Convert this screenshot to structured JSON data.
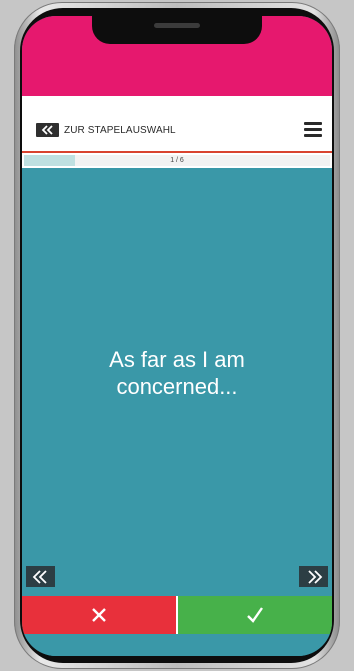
{
  "header": {
    "back_label": "ZUR STAPELAUSWAHL"
  },
  "progress": {
    "text": "1 / 6",
    "current": 1,
    "total": 6
  },
  "card": {
    "line1": "As far as I am",
    "line2": "concerned..."
  },
  "icons": {
    "back": "double-chevron-left-icon",
    "menu": "hamburger-menu-icon",
    "prev": "double-chevron-left-icon",
    "next": "double-chevron-right-icon",
    "wrong": "cross-icon",
    "right": "checkmark-icon"
  },
  "colors": {
    "top_bar": "#e6186e",
    "card": "#3a98a8",
    "header_rule": "#d9432f",
    "wrong": "#e8303b",
    "right": "#47b14a",
    "progress_fill": "#bfe0e1"
  }
}
